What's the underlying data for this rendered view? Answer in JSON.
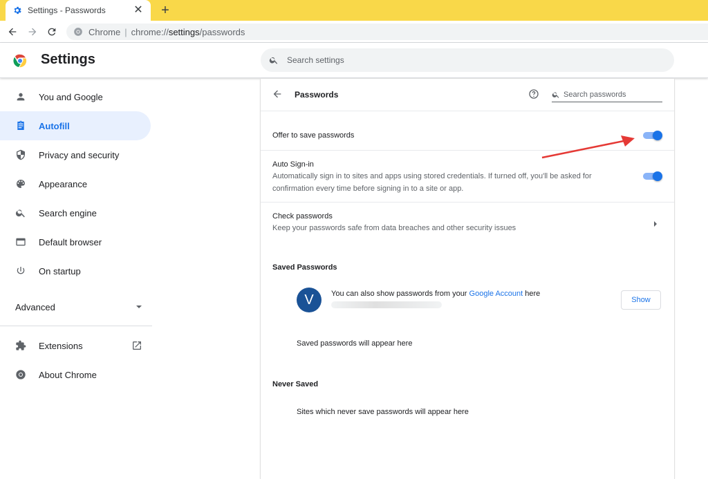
{
  "browser": {
    "tab_title": "Settings - Passwords",
    "tab_close": "✕",
    "new_tab": "+",
    "omnibox": {
      "chip": "Chrome",
      "separator": "|",
      "url_scheme": "chrome://",
      "url_host": "settings",
      "url_path": "/passwords"
    },
    "colors": {
      "tabstrip": "#f9d849",
      "omnibox": "#f1f3f4"
    }
  },
  "header": {
    "title": "Settings",
    "search_placeholder": "Search settings"
  },
  "sidebar": {
    "items": [
      {
        "label": "You and Google",
        "icon": "person-icon"
      },
      {
        "label": "Autofill",
        "icon": "clipboard-icon",
        "active": true
      },
      {
        "label": "Privacy and security",
        "icon": "shield-icon"
      },
      {
        "label": "Appearance",
        "icon": "palette-icon"
      },
      {
        "label": "Search engine",
        "icon": "search-icon"
      },
      {
        "label": "Default browser",
        "icon": "browser-window-icon"
      },
      {
        "label": "On startup",
        "icon": "power-icon"
      }
    ],
    "advanced_label": "Advanced",
    "extensions_label": "Extensions",
    "about_label": "About Chrome"
  },
  "passwords": {
    "title": "Passwords",
    "search_placeholder": "Search passwords",
    "offer_to_save": {
      "label": "Offer to save passwords",
      "enabled": true
    },
    "auto_signin": {
      "label": "Auto Sign-in",
      "description_line1": "Automatically sign in to sites and apps using stored credentials. If turned off, you'll be asked for",
      "description_line2": "confirmation every time before signing in to a site or app.",
      "enabled": true
    },
    "check_passwords": {
      "label": "Check passwords",
      "description": "Keep your passwords safe from data breaches and other security issues"
    },
    "saved": {
      "section_title": "Saved Passwords",
      "avatar_letter": "V",
      "account_text_before": "You can also show passwords from your",
      "account_link": "Google Account",
      "account_text_after": "here",
      "show_button": "Show",
      "empty_text": "Saved passwords will appear here"
    },
    "never_saved": {
      "section_title": "Never Saved",
      "empty_text": "Sites which never save passwords will appear here"
    }
  },
  "colors": {
    "accent": "#1a73e8",
    "active_nav_bg": "#e8f0fe",
    "annotation": "#e53935"
  }
}
